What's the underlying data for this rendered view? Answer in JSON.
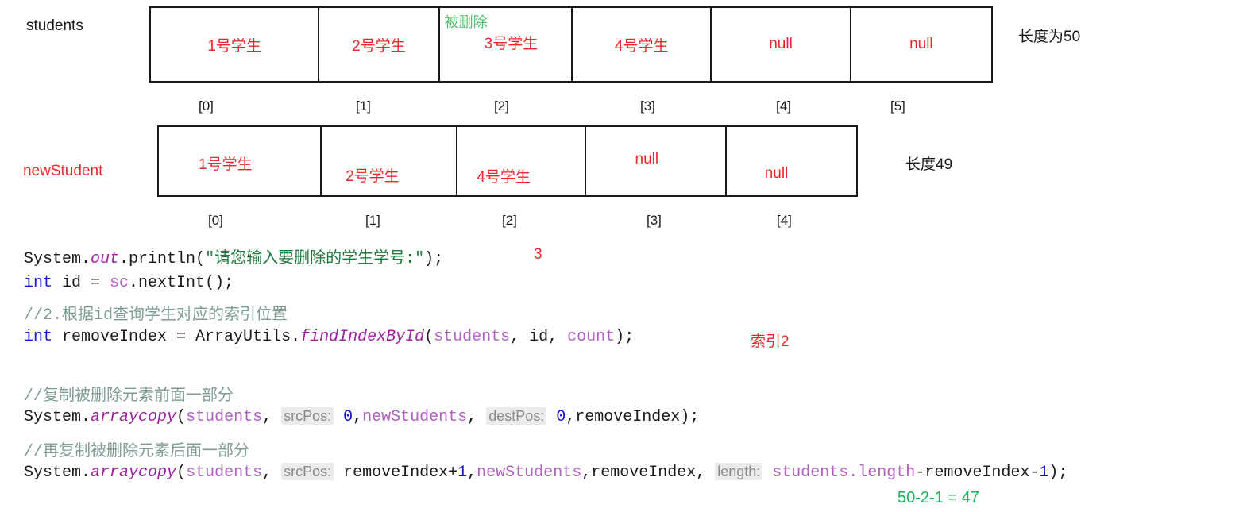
{
  "arrays": [
    {
      "name": "students",
      "name_color": "#1a1a1a",
      "length_label": "长度为50",
      "cells": [
        {
          "value": "1号学生",
          "note": ""
        },
        {
          "value": "2号学生",
          "note": ""
        },
        {
          "value": "3号学生",
          "note": "被删除"
        },
        {
          "value": "4号学生",
          "note": ""
        },
        {
          "value": "null",
          "note": ""
        },
        {
          "value": "null",
          "note": ""
        }
      ],
      "indices": [
        "[0]",
        "[1]",
        "[2]",
        "[3]",
        "[4]",
        "[5]"
      ]
    },
    {
      "name": "newStudent",
      "name_color": "#f0262b",
      "length_label": "长度49",
      "cells": [
        {
          "value": "1号学生",
          "note": ""
        },
        {
          "value": "2号学生",
          "note": ""
        },
        {
          "value": "4号学生",
          "note": ""
        },
        {
          "value": "null",
          "note": ""
        },
        {
          "value": "null",
          "note": ""
        }
      ],
      "indices": [
        "[0]",
        "[1]",
        "[2]",
        "[3]",
        "[4]"
      ]
    }
  ],
  "code": {
    "line1": {
      "system": "System.",
      "out": "out",
      "println_open": ".println(",
      "string": "\"请您输入要删除的学生学号:\"",
      "close": ");"
    },
    "line2": {
      "kw": "int",
      "mid": " id = ",
      "ident": "sc",
      "tail": ".nextInt();"
    },
    "line3_comment": "//2.根据id查询学生对应的索引位置",
    "line4": {
      "kw": "int",
      "mid": " removeIndex = ArrayUtils.",
      "method": "findIndexById",
      "open": "(",
      "arg1": "students",
      "sep1": ", id, ",
      "arg2": "count",
      "close": ");"
    },
    "line5_comment": "//复制被删除元素前面一部分",
    "line6": {
      "head": "System.",
      "method": "arraycopy",
      "open": "(",
      "arg1": "students",
      "comma1": ", ",
      "hint1": "srcPos:",
      "num1": " 0",
      "comma2": ",",
      "arg2": "newStudents",
      "comma3": ", ",
      "hint2": "destPos:",
      "num2": " 0",
      "tail": ",removeIndex);"
    },
    "line7_comment": "//再复制被删除元素后面一部分",
    "line8": {
      "head": "System.",
      "method": "arraycopy",
      "open": "(",
      "arg1": "students",
      "comma1": ", ",
      "hint1": "srcPos:",
      "expr1": " removeIndex+",
      "num1": "1",
      "comma2": ",",
      "arg2": "newStudents",
      "comma3": ",removeIndex, ",
      "hint2": "length:",
      "arg3": " students.length",
      "expr2": "-removeIndex-",
      "num2": "1",
      "close": ");"
    }
  },
  "annotations": {
    "input_value": "3",
    "index_result": "索引2",
    "length_calc": "50-2-1 = 47"
  }
}
